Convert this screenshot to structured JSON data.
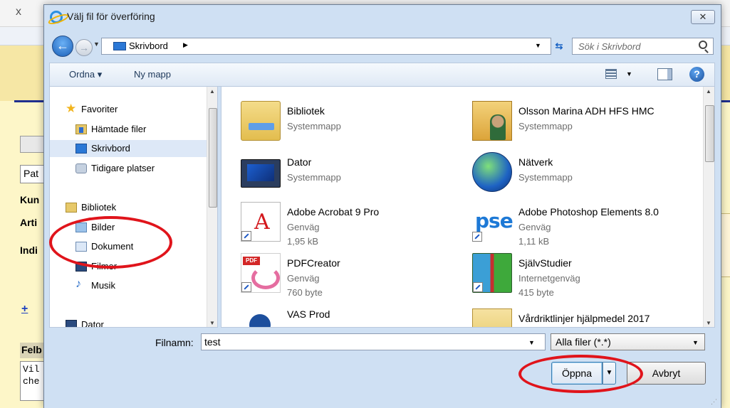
{
  "background_app": {
    "close_glyph": "x",
    "input_value": "Pat",
    "labels": [
      "Kun",
      "Arti",
      "Indi"
    ],
    "plus": "+",
    "felb": "Felb",
    "textarea_lines": [
      "Vil",
      "che"
    ]
  },
  "dialog": {
    "title": "Välj fil för överföring",
    "close_glyph": "✕",
    "address": {
      "location": "Skrivbord",
      "search_placeholder": "Sök i Skrivbord"
    },
    "toolbar": {
      "organize": "Ordna ▾",
      "new_folder": "Ny mapp",
      "help": "?"
    },
    "navigation": {
      "items": [
        {
          "label": "Favoriter",
          "icon": "star-icon"
        },
        {
          "label": "Hämtade filer",
          "icon": "downloads-folder-icon"
        },
        {
          "label": "Skrivbord",
          "icon": "desktop-icon",
          "selected": true
        },
        {
          "label": "Tidigare platser",
          "icon": "recent-places-icon"
        },
        {
          "label": "Bibliotek",
          "icon": "library-icon"
        },
        {
          "label": "Bilder",
          "icon": "pictures-icon"
        },
        {
          "label": "Dokument",
          "icon": "documents-icon"
        },
        {
          "label": "Filmer",
          "icon": "videos-icon"
        },
        {
          "label": "Musik",
          "icon": "music-icon"
        },
        {
          "label": "Dator",
          "icon": "computer-icon"
        }
      ]
    },
    "files": [
      {
        "name": "Bibliotek",
        "type": "Systemmapp",
        "size": "",
        "icon": "library-folder-icon"
      },
      {
        "name": "Olsson Marina ADH HFS HMC",
        "type": "Systemmapp",
        "size": "",
        "icon": "user-folder-icon"
      },
      {
        "name": "Dator",
        "type": "Systemmapp",
        "size": "",
        "icon": "computer-icon"
      },
      {
        "name": "Nätverk",
        "type": "Systemmapp",
        "size": "",
        "icon": "network-globe-icon"
      },
      {
        "name": "Adobe Acrobat 9 Pro",
        "type": "Genväg",
        "size": "1,95 kB",
        "icon": "acrobat-icon"
      },
      {
        "name": "Adobe Photoshop Elements 8.0",
        "type": "Genväg",
        "size": "1,11 kB",
        "icon": "photoshop-elements-icon"
      },
      {
        "name": "PDFCreator",
        "type": "Genväg",
        "size": "760 byte",
        "icon": "pdfcreator-icon"
      },
      {
        "name": "SjälvStudier",
        "type": "Internetgenväg",
        "size": "415 byte",
        "icon": "book-icon"
      },
      {
        "name": "VAS Prod",
        "type": "",
        "size": "",
        "icon": "vas-icon"
      },
      {
        "name": "Vårdriktlinjer hjälpmedel 2017",
        "type": "",
        "size": "",
        "icon": "folder-icon"
      }
    ],
    "bottom": {
      "filename_label": "Filnamn:",
      "filename_value": "test",
      "filetype_value": "Alla filer (*.*)",
      "open_label": "Öppna",
      "cancel_label": "Avbryt"
    }
  },
  "annotation_color": "#e0141b"
}
